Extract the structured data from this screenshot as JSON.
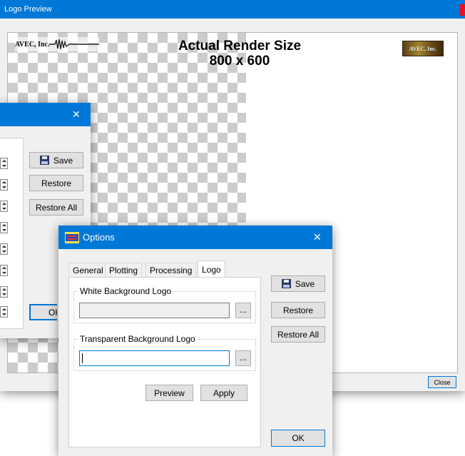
{
  "logo_preview": {
    "title": "Logo Preview",
    "logo_left_text": "AVEC, Inc.",
    "logo_right_text": "AVEC, Inc.",
    "render_label_line1": "Actual Render Size",
    "render_label_line2": "800 x 600",
    "close_label": "Close",
    "colors": {
      "title_bar": "#0078d7",
      "close_accent": "#e81123",
      "checker": "#cccccc"
    }
  },
  "back_options": {
    "close_glyph": "✕",
    "save_label": "Save",
    "restore_label": "Restore",
    "restore_all_label": "Restore All",
    "ok_label": "OK"
  },
  "options": {
    "title": "Options",
    "close_glyph": "✕",
    "tabs": [
      {
        "label": "General"
      },
      {
        "label": "Plotting"
      },
      {
        "label": "Processing"
      },
      {
        "label": "Logo"
      }
    ],
    "active_tab": "Logo",
    "white_bg_group_label": "White Background Logo",
    "white_bg_value": "",
    "transparent_bg_group_label": "Transparent Background Logo",
    "transparent_bg_value": "",
    "browse_label": "...",
    "preview_label": "Preview",
    "apply_label": "Apply",
    "save_label": "Save",
    "restore_label": "Restore",
    "restore_all_label": "Restore All",
    "ok_label": "OK",
    "icons": {
      "window_icon": "options-app-icon",
      "save_icon": "floppy-disk-icon",
      "close_icon": "close-icon"
    }
  }
}
